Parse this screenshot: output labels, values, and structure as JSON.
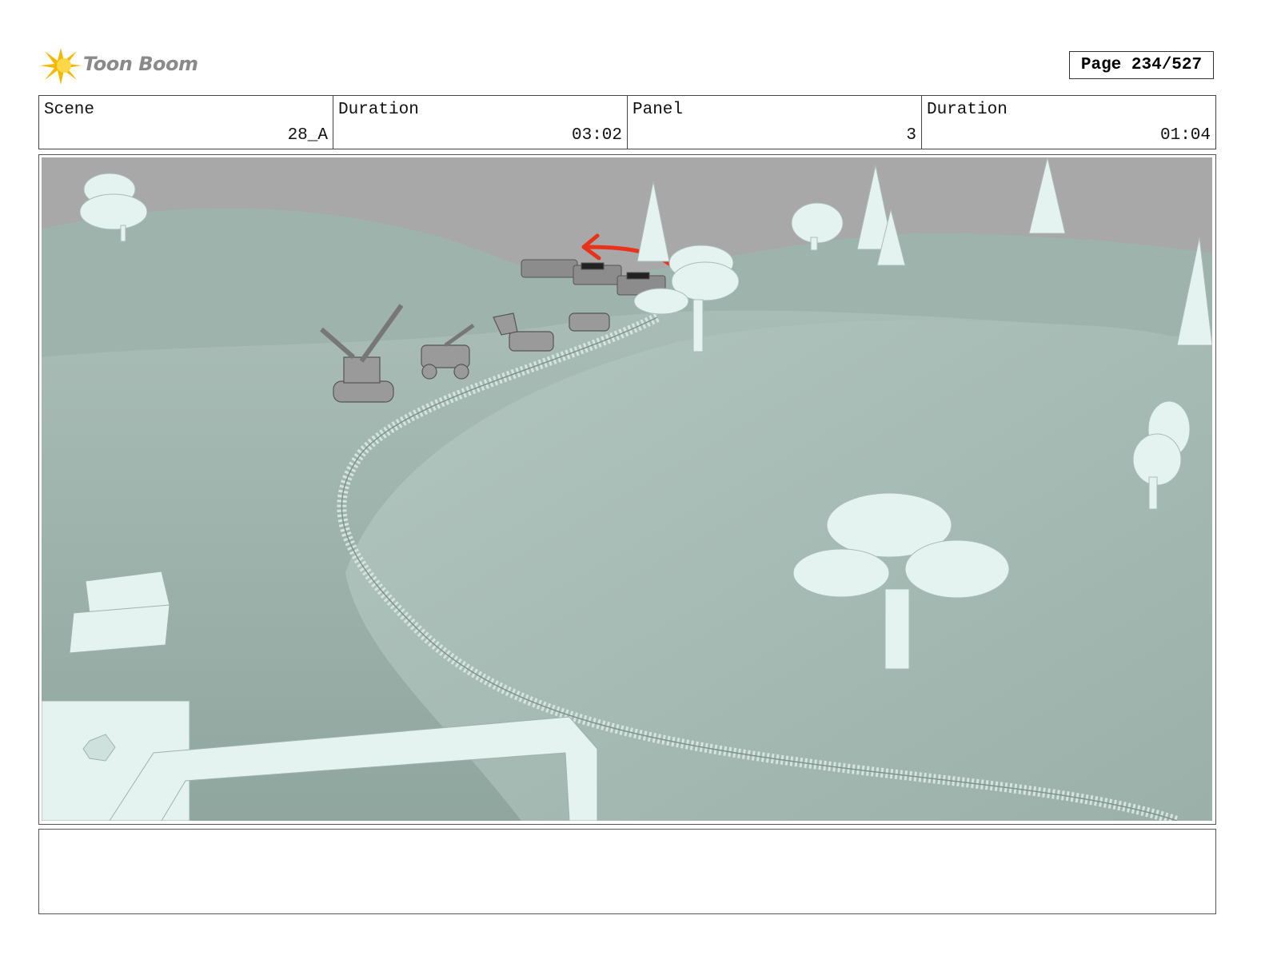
{
  "header": {
    "logo_text": "Toon Boom",
    "page_label": "Page 234/527"
  },
  "info": {
    "scene_label": "Scene",
    "scene_value": "28_A",
    "scene_duration_label": "Duration",
    "scene_duration_value": "03:02",
    "panel_label": "Panel",
    "panel_value": "3",
    "panel_duration_label": "Duration",
    "panel_duration_value": "01:04"
  },
  "panel": {
    "sky_color": "#a8a8a8",
    "ground_color": "#9fb5ae",
    "prop_color": "#e4f3ef",
    "arrow_color": "#e8331a"
  },
  "notes": {
    "text": ""
  }
}
